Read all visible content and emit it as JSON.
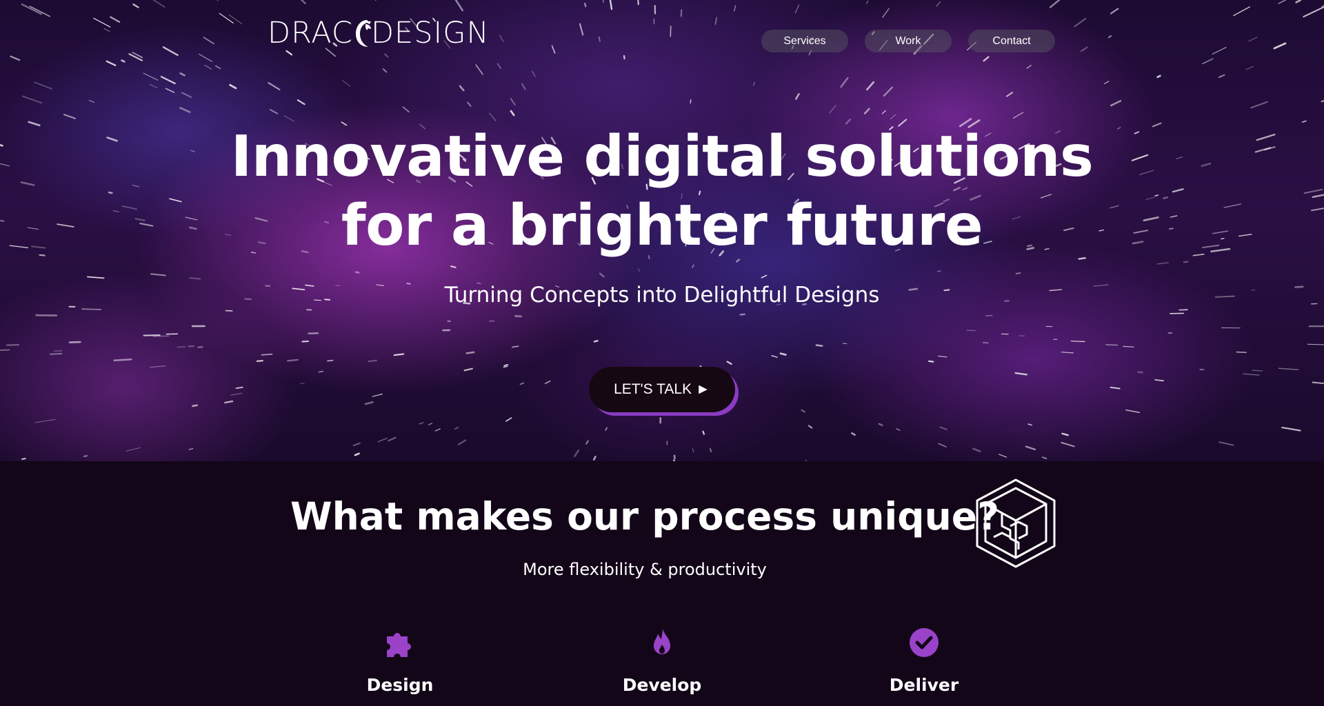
{
  "header": {
    "logo_left": "DRAC",
    "logo_right": "DESIGN",
    "nav": [
      {
        "label": "Services"
      },
      {
        "label": "Work"
      },
      {
        "label": "Contact"
      }
    ]
  },
  "hero": {
    "title_line1": "Innovative digital solutions",
    "title_line2": "for a brighter future",
    "subtitle": "Turning Concepts into Delightful Designs",
    "cta_label": "LET'S TALK",
    "cta_icon": "►"
  },
  "process": {
    "title": "What makes our process unique?",
    "subtitle": "More flexibility & productivity",
    "steps": [
      {
        "label": "Design",
        "icon": "puzzle-icon"
      },
      {
        "label": "Develop",
        "icon": "flame-icon"
      },
      {
        "label": "Deliver",
        "icon": "check-circle-icon"
      }
    ]
  },
  "colors": {
    "accent": "#8a3bc4",
    "icon_purple": "#9a43c9",
    "section_bg": "#120618",
    "button_bg": "#150813"
  }
}
